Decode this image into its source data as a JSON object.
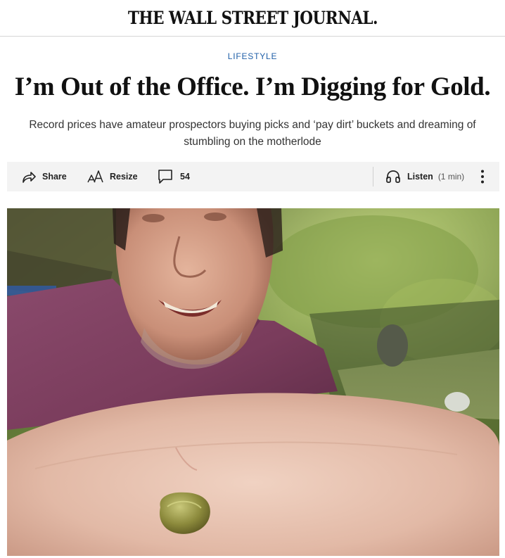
{
  "masthead": {
    "logo_text": "THE WALL STREET JOURNAL."
  },
  "article": {
    "section": "LIFESTYLE",
    "headline": "I’m Out of the Office. I’m Digging for Gold.",
    "dek_line1": "Record prices have amateur prospectors buying picks and ‘pay dirt’ buckets and dreaming of",
    "dek_line2": "stumbling on the motherlode"
  },
  "toolbar": {
    "share_label": "Share",
    "resize_label": "Resize",
    "comments_count": "54",
    "listen_label": "Listen",
    "listen_duration": "(1 min)"
  },
  "icons": {
    "share": "share-arrow-icon",
    "resize": "text-resize-icon",
    "comments": "speech-bubble-icon",
    "listen": "headphones-icon",
    "more": "vertical-ellipsis-icon"
  },
  "colors": {
    "section_label": "#1f5fa8",
    "toolbar_background": "#f3f3f3"
  }
}
